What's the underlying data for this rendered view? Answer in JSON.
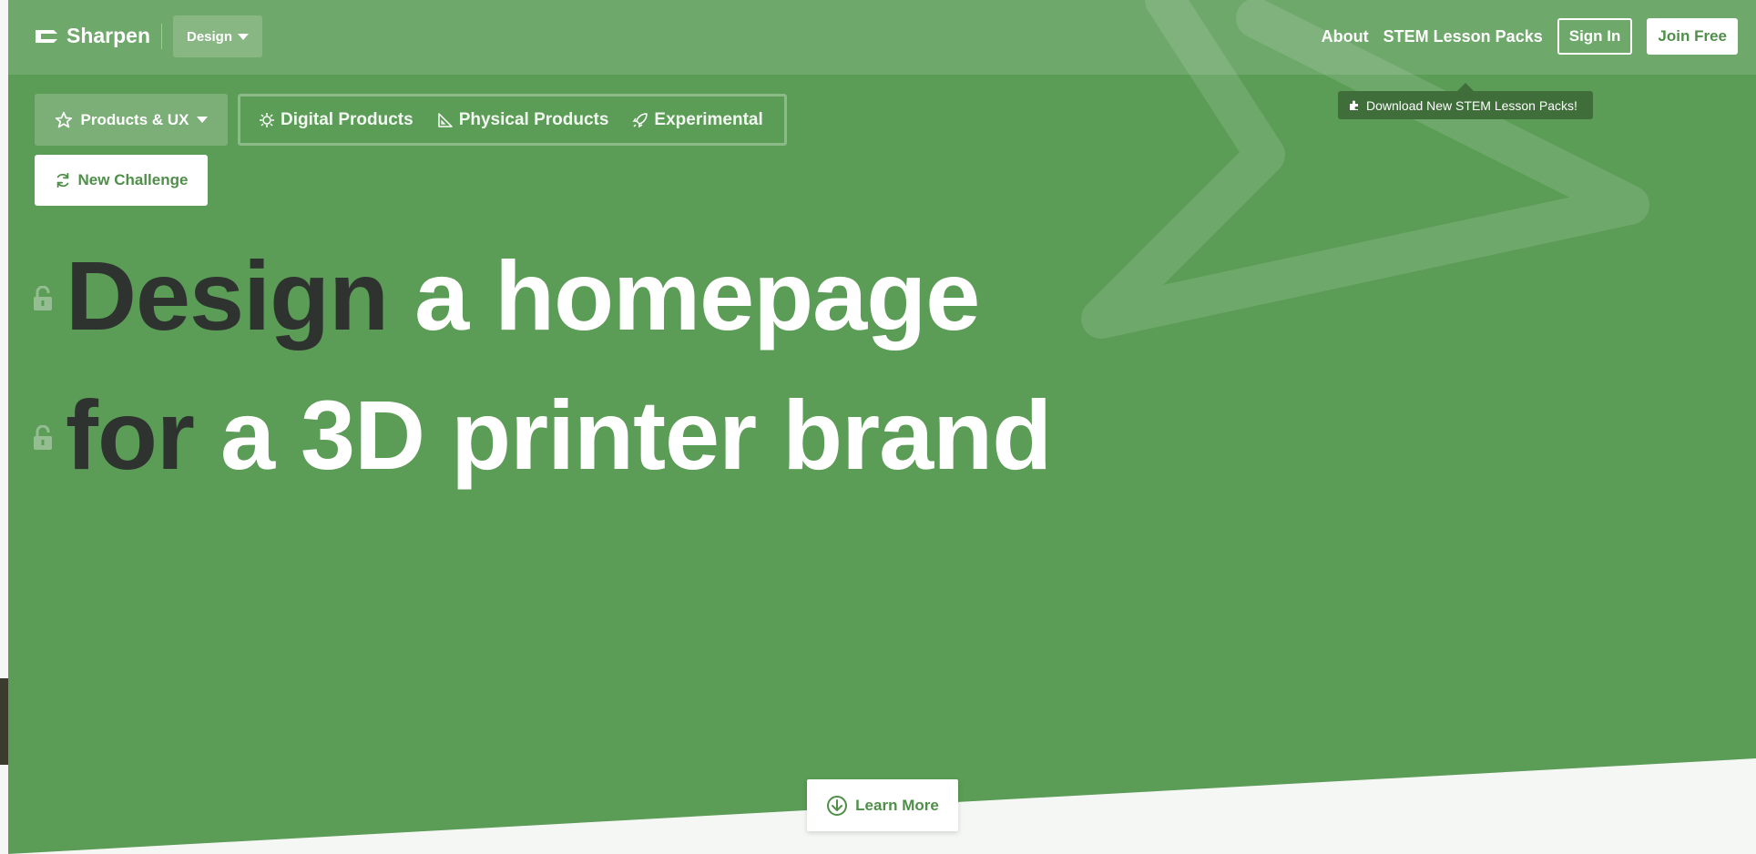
{
  "header": {
    "brand": "Sharpen",
    "category_dropdown": "Design",
    "nav_links": [
      "About",
      "STEM Lesson Packs"
    ],
    "sign_in": "Sign In",
    "join_free": "Join Free",
    "tooltip": "Download New STEM Lesson Packs!"
  },
  "categories": {
    "active": "Products & UX",
    "items": [
      {
        "label": "Digital Products",
        "icon": "bug-icon"
      },
      {
        "label": "Physical Products",
        "icon": "ruler-triangle-icon"
      },
      {
        "label": "Experimental",
        "icon": "rocket-icon"
      }
    ]
  },
  "new_challenge": "New Challenge",
  "headline": {
    "line1_dark": "Design",
    "line1_light": "a homepage",
    "line2_dark": "for",
    "line2_light": "a 3D printer brand"
  },
  "learn_more": "Learn More",
  "colors": {
    "background": "#5b9c56",
    "accent_text": "#4f8f4a",
    "dark_word": "#2f3330",
    "tooltip_bg": "#3f6e3b"
  }
}
